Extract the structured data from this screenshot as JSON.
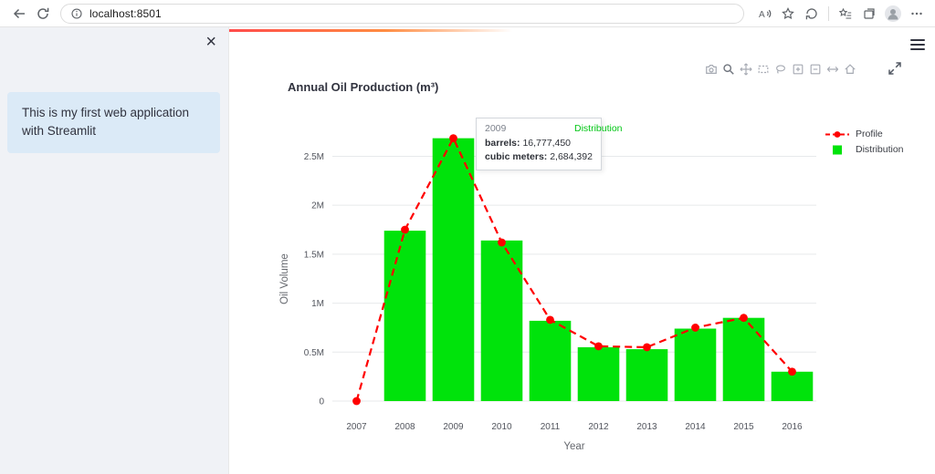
{
  "browser": {
    "url": "localhost:8501",
    "icons": [
      "back-icon",
      "refresh-icon",
      "site-info-icon",
      "read-aloud-icon",
      "add-favorite-icon",
      "circular-arrow-icon",
      "favorites-bar-icon",
      "collections-icon",
      "avatar",
      "more-icon"
    ]
  },
  "sidebar": {
    "close_glyph": "×",
    "info_text": "This is my first web application with Streamlit"
  },
  "app": {
    "menu_icon": "hamburger-menu-icon",
    "decoration_colors": [
      "#ff4b4b",
      "#ff8c42"
    ]
  },
  "modebar_icons": [
    "camera-icon",
    "zoom-icon",
    "pan-icon",
    "box-select-icon",
    "lasso-icon",
    "zoom-in-icon",
    "zoom-out-icon",
    "autoscale-icon",
    "reset-axes-icon",
    "fullscreen-icon"
  ],
  "chart_data": {
    "type": "bar",
    "title": "Annual Oil Production (m³)",
    "xlabel": "Year",
    "ylabel": "Oil Volume",
    "categories": [
      "2007",
      "2008",
      "2009",
      "2010",
      "2011",
      "2012",
      "2013",
      "2014",
      "2015",
      "2016"
    ],
    "series": [
      {
        "name": "Profile",
        "type": "line",
        "color": "#ff0000",
        "dash": true,
        "values": [
          0,
          1750000,
          2684392,
          1620000,
          830000,
          560000,
          550000,
          750000,
          850000,
          300000
        ]
      },
      {
        "name": "Distribution",
        "type": "bar",
        "color": "#00e30b",
        "values": [
          0,
          1740000,
          2684392,
          1640000,
          820000,
          550000,
          530000,
          740000,
          850000,
          300000
        ]
      }
    ],
    "ylim": [
      0,
      2830000
    ],
    "yticks": [
      {
        "value": 0,
        "label": "0"
      },
      {
        "value": 500000,
        "label": "0.5M"
      },
      {
        "value": 1000000,
        "label": "1M"
      },
      {
        "value": 1500000,
        "label": "1.5M"
      },
      {
        "value": 2000000,
        "label": "2M"
      },
      {
        "value": 2500000,
        "label": "2.5M"
      }
    ],
    "grid": true,
    "legend_position": "right",
    "tooltip": {
      "title": "2009",
      "lines": [
        {
          "label": "barrels:",
          "value": "16,777,450"
        },
        {
          "label": "cubic meters:",
          "value": "2,684,392"
        }
      ],
      "series_label": "Distribution"
    }
  }
}
